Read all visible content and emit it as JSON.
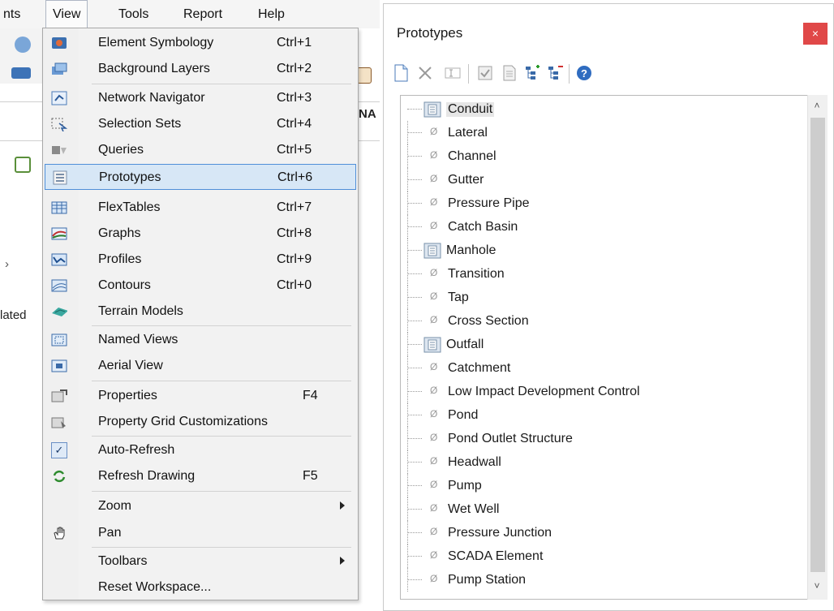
{
  "menubar": {
    "items": [
      {
        "label": "nts"
      },
      {
        "label": "View"
      },
      {
        "label": "Tools"
      },
      {
        "label": "Report"
      },
      {
        "label": "Help"
      }
    ]
  },
  "background": {
    "partial_labels": [
      "NA",
      "lated"
    ]
  },
  "view_menu": {
    "items": [
      {
        "label": "Element Symbology",
        "shortcut": "Ctrl+1",
        "icon": "element-symbology-icon"
      },
      {
        "label": "Background Layers",
        "shortcut": "Ctrl+2",
        "icon": "background-layers-icon"
      },
      {
        "label": "Network Navigator",
        "shortcut": "Ctrl+3",
        "icon": "network-navigator-icon"
      },
      {
        "label": "Selection Sets",
        "shortcut": "Ctrl+4",
        "icon": "selection-sets-icon"
      },
      {
        "label": "Queries",
        "shortcut": "Ctrl+5",
        "icon": "queries-icon"
      },
      {
        "label": "Prototypes",
        "shortcut": "Ctrl+6",
        "icon": "prototypes-icon",
        "selected": true
      },
      {
        "label": "FlexTables",
        "shortcut": "Ctrl+7",
        "icon": "flextables-icon"
      },
      {
        "label": "Graphs",
        "shortcut": "Ctrl+8",
        "icon": "graphs-icon"
      },
      {
        "label": "Profiles",
        "shortcut": "Ctrl+9",
        "icon": "profiles-icon"
      },
      {
        "label": "Contours",
        "shortcut": "Ctrl+0",
        "icon": "contours-icon"
      },
      {
        "label": "Terrain Models",
        "shortcut": "",
        "icon": "terrain-models-icon"
      },
      {
        "label": "Named Views",
        "shortcut": "",
        "icon": "named-views-icon"
      },
      {
        "label": "Aerial View",
        "shortcut": "",
        "icon": "aerial-view-icon"
      },
      {
        "label": "Properties",
        "shortcut": "F4",
        "icon": "properties-icon"
      },
      {
        "label": "Property Grid Customizations",
        "shortcut": "",
        "icon": "property-grid-icon"
      },
      {
        "label": "Auto-Refresh",
        "shortcut": "",
        "icon": "checkmark-icon",
        "checked": true
      },
      {
        "label": "Refresh Drawing",
        "shortcut": "F5",
        "icon": "refresh-icon"
      },
      {
        "label": "Zoom",
        "shortcut": "",
        "icon": "",
        "submenu": true
      },
      {
        "label": "Pan",
        "shortcut": "",
        "icon": "hand-icon"
      },
      {
        "label": "Toolbars",
        "shortcut": "",
        "icon": "",
        "submenu": true
      },
      {
        "label": "Reset Workspace...",
        "shortcut": "",
        "icon": ""
      }
    ]
  },
  "prototypes_panel": {
    "title": "Prototypes",
    "close_glyph": "×",
    "toolbar_icons": [
      "new-icon",
      "delete-icon",
      "rename-icon",
      "make-default-icon",
      "report-icon",
      "expand-all-icon",
      "collapse-all-icon",
      "help-icon"
    ],
    "tree": [
      {
        "label": "Conduit",
        "type": "category"
      },
      {
        "label": "Lateral",
        "type": "empty"
      },
      {
        "label": "Channel",
        "type": "empty"
      },
      {
        "label": "Gutter",
        "type": "empty"
      },
      {
        "label": "Pressure Pipe",
        "type": "empty"
      },
      {
        "label": "Catch Basin",
        "type": "empty"
      },
      {
        "label": "Manhole",
        "type": "category"
      },
      {
        "label": "Transition",
        "type": "empty"
      },
      {
        "label": "Tap",
        "type": "empty"
      },
      {
        "label": "Cross Section",
        "type": "empty"
      },
      {
        "label": "Outfall",
        "type": "category"
      },
      {
        "label": "Catchment",
        "type": "empty"
      },
      {
        "label": "Low Impact Development Control",
        "type": "empty"
      },
      {
        "label": "Pond",
        "type": "empty"
      },
      {
        "label": "Pond Outlet Structure",
        "type": "empty"
      },
      {
        "label": "Headwall",
        "type": "empty"
      },
      {
        "label": "Pump",
        "type": "empty"
      },
      {
        "label": "Wet Well",
        "type": "empty"
      },
      {
        "label": "Pressure Junction",
        "type": "empty"
      },
      {
        "label": "SCADA Element",
        "type": "empty"
      },
      {
        "label": "Pump Station",
        "type": "empty"
      }
    ],
    "empty_glyph": "Ø"
  }
}
